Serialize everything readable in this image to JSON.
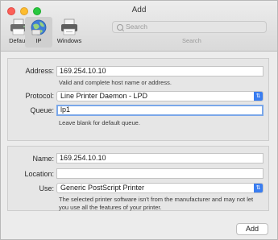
{
  "window": {
    "title": "Add"
  },
  "toolbar": {
    "buttons": [
      {
        "label": "Default",
        "icon": "printer-icon"
      },
      {
        "label": "IP",
        "icon": "globe-icon",
        "selected": true
      },
      {
        "label": "Windows",
        "icon": "printer-network-icon"
      }
    ],
    "search": {
      "placeholder": "Search",
      "caption": "Search"
    }
  },
  "form": {
    "address": {
      "label": "Address:",
      "value": "169.254.10.10",
      "hint": "Valid and complete host name or address."
    },
    "protocol": {
      "label": "Protocol:",
      "value": "Line Printer Daemon - LPD"
    },
    "queue": {
      "label": "Queue:",
      "value": "lp1",
      "hint": "Leave blank for default queue."
    },
    "name": {
      "label": "Name:",
      "value": "169.254.10.10"
    },
    "location": {
      "label": "Location:",
      "value": ""
    },
    "use": {
      "label": "Use:",
      "value": "Generic PostScript Printer",
      "hint_line1": "The selected printer software isn't from the manufacturer and may not let",
      "hint_line2": "you use all the features of your printer."
    }
  },
  "actions": {
    "add_label": "Add"
  },
  "colors": {
    "accent": "#3a7df0",
    "focus_ring": "#7aa7e9",
    "close": "#fc5f57",
    "minimize": "#fdbc2e",
    "zoom": "#28c840"
  }
}
